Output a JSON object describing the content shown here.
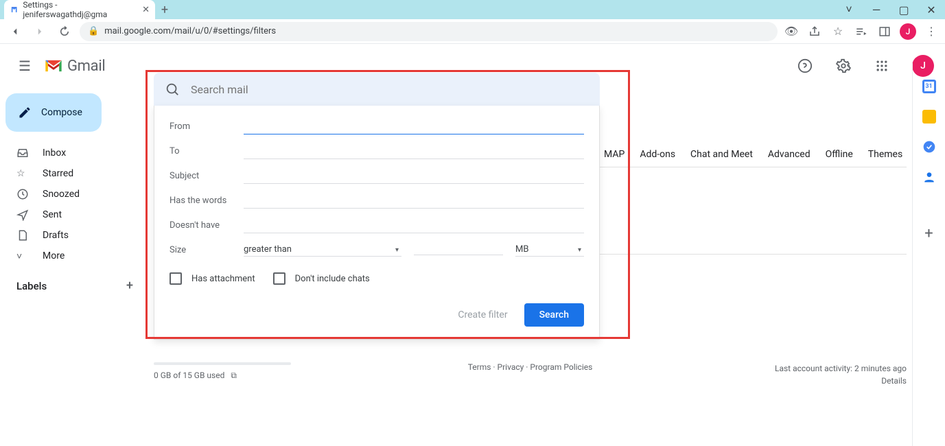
{
  "browser": {
    "tab_title": "Settings - jeniferswagathdj@gma",
    "url": "mail.google.com/mail/u/0/#settings/filters"
  },
  "header": {
    "product": "Gmail",
    "avatar_initial": "J"
  },
  "compose_label": "Compose",
  "nav_items": [
    "Inbox",
    "Starred",
    "Snoozed",
    "Sent",
    "Drafts",
    "More"
  ],
  "labels_heading": "Labels",
  "search": {
    "placeholder": "Search mail"
  },
  "filter": {
    "from": "From",
    "to": "To",
    "subject": "Subject",
    "has_words": "Has the words",
    "doesnt_have": "Doesn't have",
    "size": "Size",
    "size_op": "greater than",
    "size_unit": "MB",
    "has_attachment": "Has attachment",
    "dont_include_chats": "Don't include chats",
    "create_filter": "Create filter",
    "search_btn": "Search"
  },
  "tabs_partial": [
    "MAP",
    "Add-ons",
    "Chat and Meet",
    "Advanced",
    "Offline",
    "Themes"
  ],
  "footer": {
    "storage": "0 GB of 15 GB used",
    "terms": "Terms",
    "privacy": "Privacy",
    "policies": "Program Policies",
    "activity": "Last account activity: 2 minutes ago",
    "details": "Details"
  }
}
